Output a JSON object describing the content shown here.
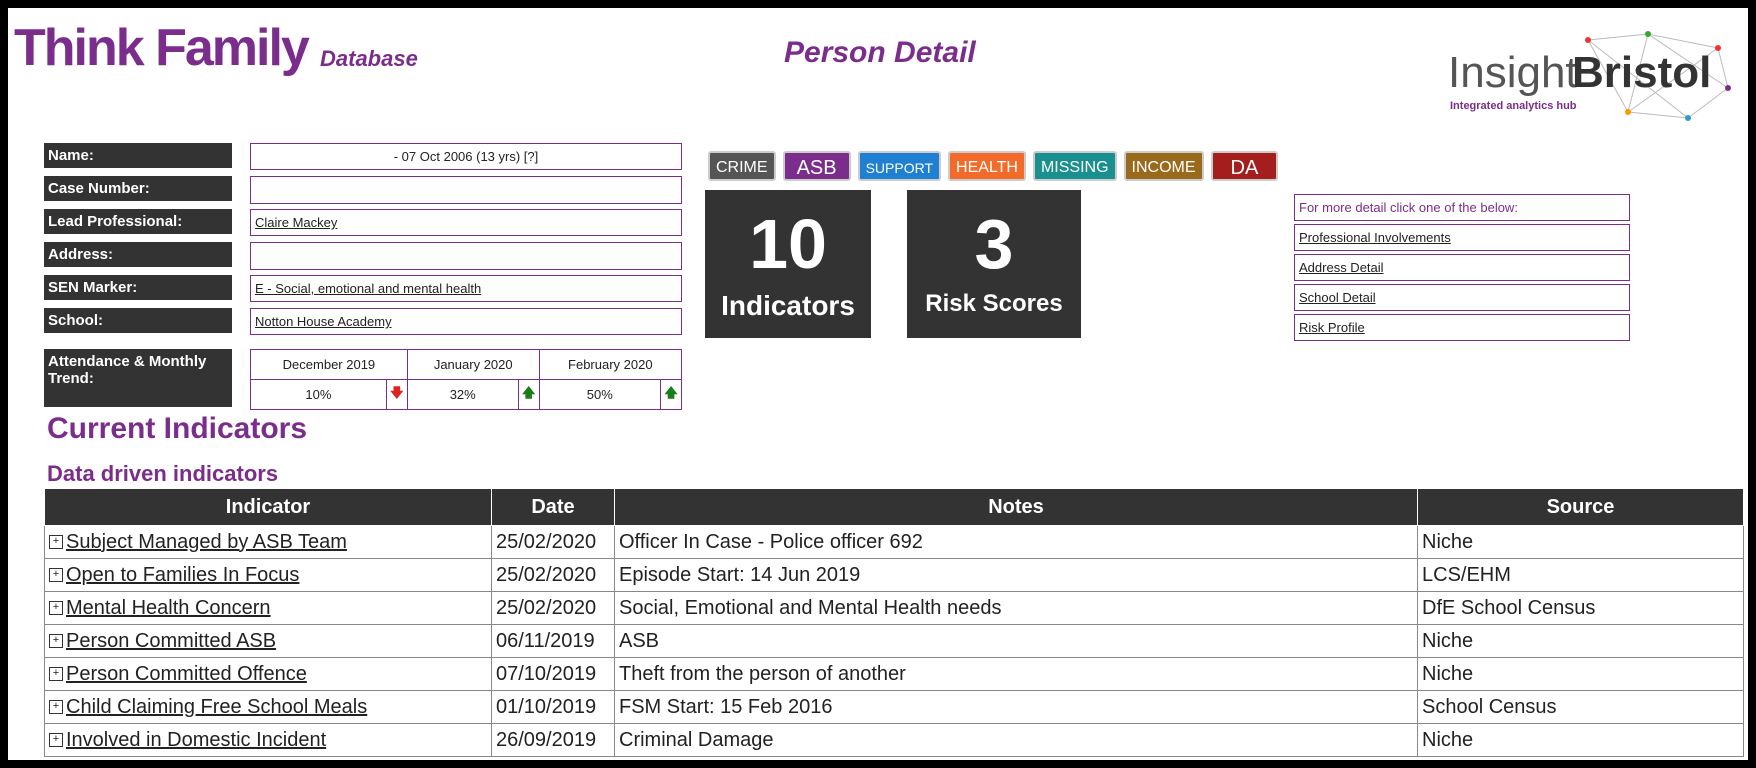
{
  "header": {
    "brand": "Think Family",
    "brand_sub": "Database",
    "page_title": "Person Detail",
    "logo_insight": "Insight",
    "logo_bristol": "Bristol",
    "logo_tagline": "Integrated analytics hub"
  },
  "person": {
    "labels": {
      "name": "Name:",
      "case_number": "Case Number:",
      "lead_professional": "Lead Professional:",
      "address": "Address:",
      "sen_marker": "SEN Marker:",
      "school": "School:",
      "attendance": "Attendance & Monthly Trend:"
    },
    "name": "- 07 Oct 2006 (13 yrs) [?]",
    "case_number": "",
    "lead_professional": "Claire Mackey",
    "address": "",
    "sen_marker": "E - Social, emotional and mental health",
    "school": "Notton House Academy",
    "attendance": [
      {
        "month": "December 2019",
        "value": "10%",
        "trend": "down"
      },
      {
        "month": "January 2020",
        "value": "32%",
        "trend": "up"
      },
      {
        "month": "February 2020",
        "value": "50%",
        "trend": "up"
      }
    ]
  },
  "tags": [
    {
      "label": "CRIME",
      "color": "#555555"
    },
    {
      "label": "ASB",
      "color": "#7b2d8b"
    },
    {
      "label": "SUPPORT",
      "color": "#1f7fd0"
    },
    {
      "label": "HEALTH",
      "color": "#f26b2a"
    },
    {
      "label": "MISSING",
      "color": "#1a8f8f"
    },
    {
      "label": "INCOME",
      "color": "#9a6a1c"
    },
    {
      "label": "DA",
      "color": "#a41e1e"
    }
  ],
  "tiles": {
    "indicators_count": "10",
    "indicators_label": "Indicators",
    "risk_count": "3",
    "risk_label": "Risk Scores"
  },
  "detail_links": {
    "prompt": "For more detail click one of the below:",
    "items": [
      "Professional Involvements",
      "Address Detail",
      "School Detail",
      "Risk Profile"
    ]
  },
  "indicators": {
    "title": "Current Indicators",
    "subtitle": "Data driven indicators",
    "columns": [
      "Indicator",
      "Date",
      "Notes",
      "Source"
    ],
    "rows": [
      {
        "indicator": "Subject Managed by ASB Team",
        "date": "25/02/2020",
        "notes": "Officer In Case - Police officer 692",
        "source": "Niche"
      },
      {
        "indicator": "Open to Families In Focus",
        "date": "25/02/2020",
        "notes": "Episode Start: 14 Jun 2019",
        "source": "LCS/EHM"
      },
      {
        "indicator": "Mental Health Concern",
        "date": "25/02/2020",
        "notes": "Social, Emotional and Mental Health needs",
        "source": "DfE School Census"
      },
      {
        "indicator": "Person Committed ASB",
        "date": "06/11/2019",
        "notes": "ASB",
        "source": "Niche"
      },
      {
        "indicator": "Person Committed Offence",
        "date": "07/10/2019",
        "notes": "Theft from the person of another",
        "source": "Niche"
      },
      {
        "indicator": "Child Claiming Free School Meals",
        "date": "01/10/2019",
        "notes": "FSM Start: 15 Feb 2016",
        "source": "School Census"
      },
      {
        "indicator": "Involved in Domestic Incident",
        "date": "26/09/2019",
        "notes": "Criminal Damage",
        "source": "Niche"
      }
    ]
  }
}
